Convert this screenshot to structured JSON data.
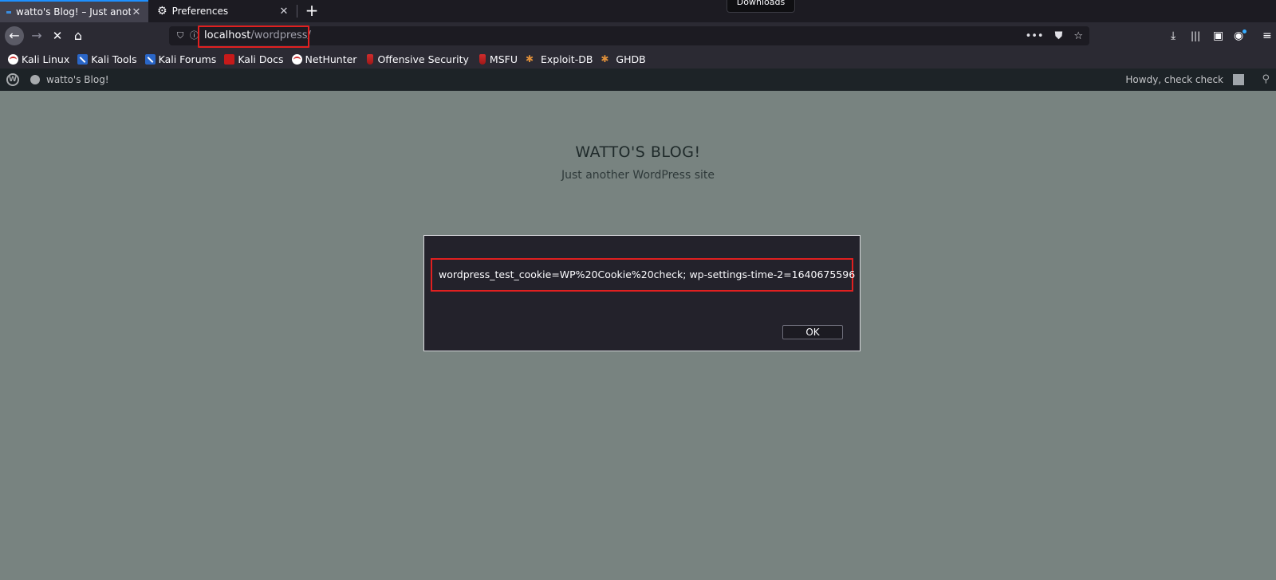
{
  "tabs": [
    {
      "title": "watto's Blog! – Just anoth",
      "active": true
    },
    {
      "title": "Preferences",
      "active": false
    }
  ],
  "tooltip": "Downloads",
  "urlbar": {
    "host": "localhost",
    "path": "/wordpress/"
  },
  "bookmarks": [
    {
      "label": "Kali Linux",
      "icon": "kali-icon"
    },
    {
      "label": "Kali Tools",
      "icon": "kali-tools-icon"
    },
    {
      "label": "Kali Forums",
      "icon": "kali-tools-icon"
    },
    {
      "label": "Kali Docs",
      "icon": "kali-docs-icon"
    },
    {
      "label": "NetHunter",
      "icon": "kali-icon"
    },
    {
      "label": "Offensive Security",
      "icon": "flask-icon"
    },
    {
      "label": "MSFU",
      "icon": "flask-icon"
    },
    {
      "label": "Exploit-DB",
      "icon": "bug-icon"
    },
    {
      "label": "GHDB",
      "icon": "bug-icon"
    }
  ],
  "wpbar": {
    "site_name": "watto's Blog!",
    "howdy": "Howdy, check check"
  },
  "page": {
    "title": "WATTO'S BLOG!",
    "tagline": "Just another WordPress site"
  },
  "dialog": {
    "message": "wordpress_test_cookie=WP%20Cookie%20check; wp-settings-time-2=1640675596",
    "ok_label": "OK"
  }
}
